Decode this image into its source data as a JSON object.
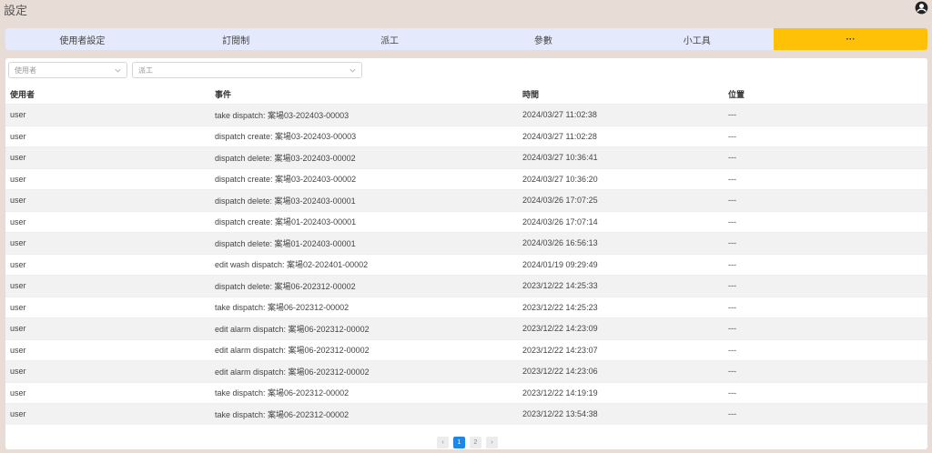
{
  "header": {
    "title": "設定",
    "account_icon": "account-circle-icon"
  },
  "tabs": [
    {
      "label": "使用者設定"
    },
    {
      "label": "訂閱制"
    },
    {
      "label": "派工"
    },
    {
      "label": "參數"
    },
    {
      "label": "小工具"
    },
    {
      "label": "···",
      "active": true
    }
  ],
  "colors": {
    "active_tab": "#ffc107",
    "tab_bar": "#e4e9fb",
    "page_bg": "#e8dcd6",
    "pager_active": "#1e88e5"
  },
  "filters": {
    "user_select": {
      "value": "使用者"
    },
    "type_select": {
      "value": "派工"
    }
  },
  "table": {
    "columns": [
      "使用者",
      "事件",
      "時間",
      "位置"
    ],
    "rows": [
      [
        "user",
        "take dispatch: 案場03-202403-00003",
        "2024/03/27 11:02:38",
        "---"
      ],
      [
        "user",
        "dispatch create: 案場03-202403-00003",
        "2024/03/27 11:02:28",
        "---"
      ],
      [
        "user",
        "dispatch delete: 案場03-202403-00002",
        "2024/03/27 10:36:41",
        "---"
      ],
      [
        "user",
        "dispatch create: 案場03-202403-00002",
        "2024/03/27 10:36:20",
        "---"
      ],
      [
        "user",
        "dispatch delete: 案場03-202403-00001",
        "2024/03/26 17:07:25",
        "---"
      ],
      [
        "user",
        "dispatch create: 案場01-202403-00001",
        "2024/03/26 17:07:14",
        "---"
      ],
      [
        "user",
        "dispatch delete: 案場01-202403-00001",
        "2024/03/26 16:56:13",
        "---"
      ],
      [
        "user",
        "edit wash dispatch: 案場02-202401-00002",
        "2024/01/19 09:29:49",
        "---"
      ],
      [
        "user",
        "dispatch delete: 案場06-202312-00002",
        "2023/12/22 14:25:33",
        "---"
      ],
      [
        "user",
        "take dispatch: 案場06-202312-00002",
        "2023/12/22 14:25:23",
        "---"
      ],
      [
        "user",
        "edit alarm dispatch: 案場06-202312-00002",
        "2023/12/22 14:23:09",
        "---"
      ],
      [
        "user",
        "edit alarm dispatch: 案場06-202312-00002",
        "2023/12/22 14:23:07",
        "---"
      ],
      [
        "user",
        "edit alarm dispatch: 案場06-202312-00002",
        "2023/12/22 14:23:06",
        "---"
      ],
      [
        "user",
        "take dispatch: 案場06-202312-00002",
        "2023/12/22 14:19:19",
        "---"
      ],
      [
        "user",
        "take dispatch: 案場06-202312-00002",
        "2023/12/22 13:54:38",
        "---"
      ]
    ]
  },
  "pagination": {
    "prev": "‹",
    "pages": [
      "1",
      "2"
    ],
    "current": "1",
    "next": "›"
  }
}
